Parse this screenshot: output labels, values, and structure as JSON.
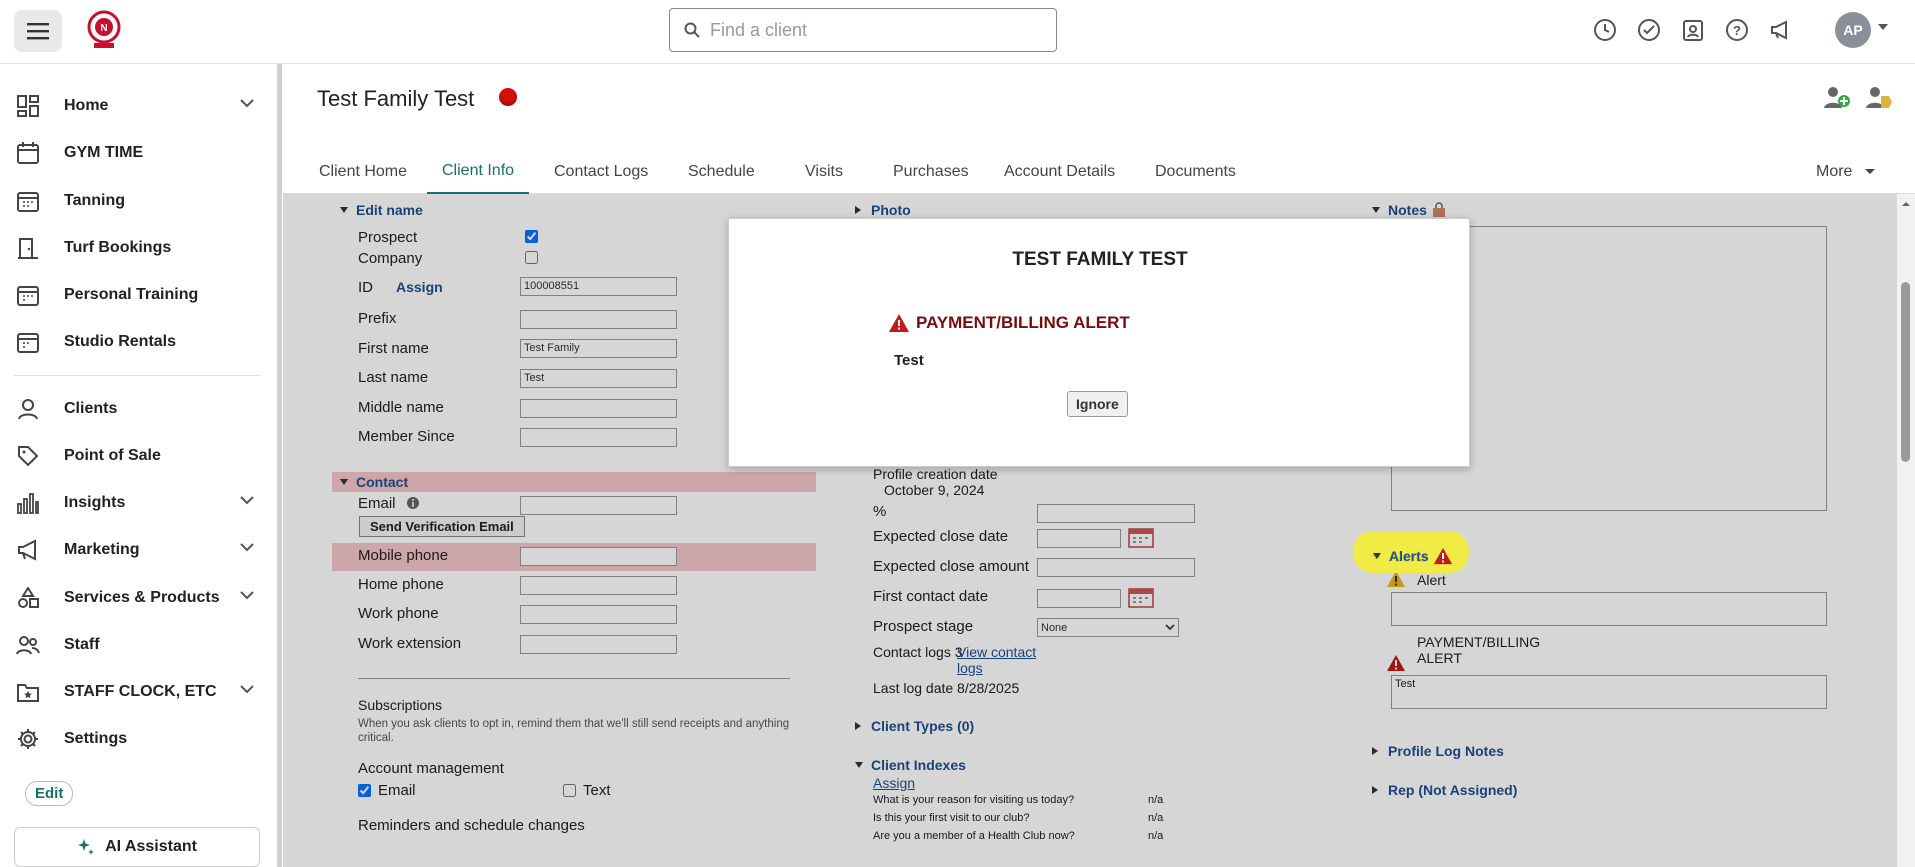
{
  "header": {
    "search_placeholder": "Find a client",
    "avatar_initials": "AP"
  },
  "sidebar": {
    "items": [
      {
        "label": "Home",
        "icon": "dashboard-icon",
        "chevron": true
      },
      {
        "label": "GYM TIME",
        "icon": "calendar-icon",
        "chevron": false
      },
      {
        "label": "Tanning",
        "icon": "calendar-grid-icon",
        "chevron": false
      },
      {
        "label": "Turf Bookings",
        "icon": "door-icon",
        "chevron": false
      },
      {
        "label": "Personal Training",
        "icon": "calendar-grid-icon",
        "chevron": false
      },
      {
        "label": "Studio Rentals",
        "icon": "calendar-grid-icon",
        "chevron": false
      },
      {
        "label": "Clients",
        "icon": "person-icon",
        "chevron": false
      },
      {
        "label": "Point of Sale",
        "icon": "tag-icon",
        "chevron": false
      },
      {
        "label": "Insights",
        "icon": "bar-chart-icon",
        "chevron": true
      },
      {
        "label": "Marketing",
        "icon": "megaphone-icon",
        "chevron": true
      },
      {
        "label": "Services & Products",
        "icon": "shapes-icon",
        "chevron": true
      },
      {
        "label": "Staff",
        "icon": "people-icon",
        "chevron": false
      },
      {
        "label": "STAFF CLOCK, ETC",
        "icon": "folder-star-icon",
        "chevron": true
      },
      {
        "label": "Settings",
        "icon": "gear-icon",
        "chevron": false
      }
    ],
    "edit_label": "Edit",
    "ai_label": "AI Assistant"
  },
  "client": {
    "name": "Test Family Test",
    "tabs": [
      "Client Home",
      "Client Info",
      "Contact Logs",
      "Schedule",
      "Visits",
      "Purchases",
      "Account Details",
      "Documents"
    ],
    "more_label": "More"
  },
  "left": {
    "edit_name": "Edit name",
    "prospect": "Prospect",
    "company": "Company",
    "id_label": "ID",
    "assign": "Assign",
    "id_value": "100008551",
    "prefix": "Prefix",
    "first_name": "First name",
    "first_name_value": "Test Family",
    "last_name": "Last name",
    "last_name_value": "Test",
    "middle_name": "Middle name",
    "member_since": "Member Since",
    "contact": "Contact",
    "email": "Email",
    "send_verification": "Send Verification Email",
    "mobile_phone": "Mobile phone",
    "home_phone": "Home phone",
    "work_phone": "Work phone",
    "work_extension": "Work extension",
    "subscriptions": "Subscriptions",
    "subscriptions_note": "When you ask clients to opt in, remind them that we'll still send receipts and anything critical.",
    "account_management": "Account management",
    "email_opt": "Email",
    "text_opt": "Text",
    "reminders": "Reminders and schedule changes"
  },
  "middle": {
    "photo": "Photo",
    "profile_creation_label": "Profile creation date",
    "profile_creation_value": "October 9, 2024",
    "percent": "%",
    "expected_close_date": "Expected close date",
    "expected_close_amount": "Expected close amount",
    "first_contact_date": "First contact date",
    "prospect_stage": "Prospect stage",
    "prospect_stage_value": "None",
    "contact_logs": "Contact logs 3",
    "view_contact_logs": "View contact logs",
    "last_log_date": "Last log date 8/28/2025",
    "client_types": "Client Types (0)",
    "client_indexes": "Client Indexes",
    "assign": "Assign",
    "indexes": [
      {
        "q": "What is your reason for visiting us today?",
        "a": "n/a"
      },
      {
        "q": "Is this your first visit to our club?",
        "a": "n/a"
      },
      {
        "q": "Are you a member of a Health Club now?",
        "a": "n/a"
      }
    ]
  },
  "right": {
    "notes": "Notes",
    "alerts": "Alerts",
    "alert_label": "Alert",
    "payment_label": "PAYMENT/BILLING ALERT",
    "payment_value": "Test",
    "profile_log_notes": "Profile Log Notes",
    "rep": "Rep (Not Assigned)"
  },
  "modal": {
    "title": "TEST FAMILY TEST",
    "alert_title": "PAYMENT/BILLING ALERT",
    "message": "Test",
    "ignore": "Ignore"
  }
}
